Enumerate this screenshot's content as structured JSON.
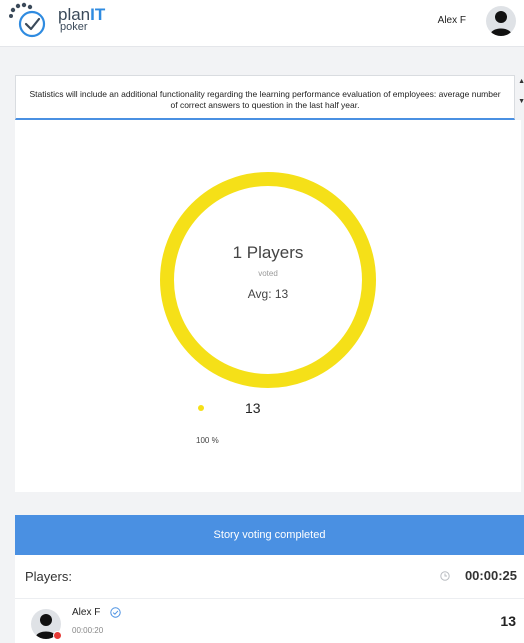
{
  "brand": {
    "plan": "plan",
    "it": "IT",
    "poker": "poker"
  },
  "header": {
    "user_name": "Alex F"
  },
  "story": {
    "text": "Statistics will include an additional functionality regarding the learning performance evaluation of employees: average number of correct answers to question in the last half year."
  },
  "results": {
    "players_count": "1 Players",
    "voted_label": "voted",
    "average": "Avg: 13",
    "legend": [
      {
        "value": "13",
        "percent": "100 %",
        "color": "#f5e018"
      }
    ]
  },
  "chart_data": {
    "type": "pie",
    "categories": [
      "13"
    ],
    "values": [
      100
    ]
  },
  "status": {
    "voting": "Story voting completed"
  },
  "players": {
    "label": "Players:",
    "timer": "00:00:25",
    "list": [
      {
        "name": "Alex F",
        "time": "00:00:20",
        "vote": "13"
      }
    ]
  }
}
